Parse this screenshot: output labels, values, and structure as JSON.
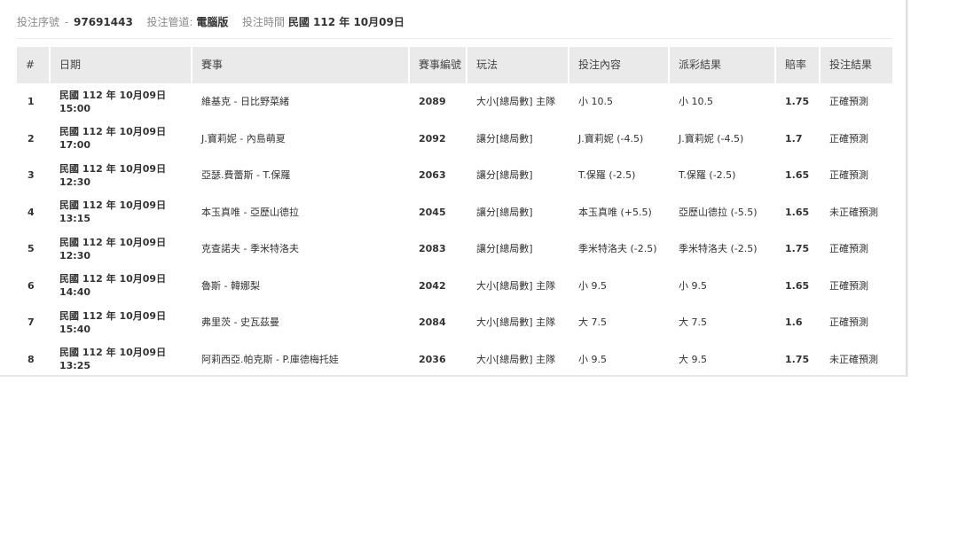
{
  "header": {
    "serial_label": "投注序號",
    "serial_sep": "-",
    "serial_value": "97691443",
    "channel_label": "投注管道:",
    "channel_value": "電腦版",
    "time_label": "投注時間",
    "time_value": "民國 112 年 10月09日"
  },
  "table": {
    "columns": [
      "#",
      "日期",
      "賽事",
      "賽事編號",
      "玩法",
      "投注內容",
      "派彩結果",
      "賠率",
      "投注結果"
    ],
    "rows": [
      {
        "idx": "1",
        "date": "民國 112 年 10月09日",
        "time": "15:00",
        "match": "維基克 - 日比野菜緒",
        "match_no": "2089",
        "play": "大小[總局數] 主隊",
        "bet": "小 10.5",
        "payout": "小 10.5",
        "odds": "1.75",
        "result": "正確預測"
      },
      {
        "idx": "2",
        "date": "民國 112 年 10月09日",
        "time": "17:00",
        "match": "J.寶莉妮 - 內島萌夏",
        "match_no": "2092",
        "play": "讓分[總局數]",
        "bet": "J.寶莉妮 (-4.5)",
        "payout": "J.寶莉妮 (-4.5)",
        "odds": "1.7",
        "result": "正確預測"
      },
      {
        "idx": "3",
        "date": "民國 112 年 10月09日",
        "time": "12:30",
        "match": "亞瑟.費蕾斯 - T.保羅",
        "match_no": "2063",
        "play": "讓分[總局數]",
        "bet": "T.保羅 (-2.5)",
        "payout": "T.保羅 (-2.5)",
        "odds": "1.65",
        "result": "正確預測"
      },
      {
        "idx": "4",
        "date": "民國 112 年 10月09日",
        "time": "13:15",
        "match": "本玉真唯 - 亞歷山德拉",
        "match_no": "2045",
        "play": "讓分[總局數]",
        "bet": "本玉真唯 (+5.5)",
        "payout": "亞歷山德拉 (-5.5)",
        "odds": "1.65",
        "result": "未正確預測"
      },
      {
        "idx": "5",
        "date": "民國 112 年 10月09日",
        "time": "12:30",
        "match": "克查諾夫 - 季米特洛夫",
        "match_no": "2083",
        "play": "讓分[總局數]",
        "bet": "季米特洛夫 (-2.5)",
        "payout": "季米特洛夫 (-2.5)",
        "odds": "1.75",
        "result": "正確預測"
      },
      {
        "idx": "6",
        "date": "民國 112 年 10月09日",
        "time": "14:40",
        "match": "魯斯 - 韓娜梨",
        "match_no": "2042",
        "play": "大小[總局數] 主隊",
        "bet": "小 9.5",
        "payout": "小 9.5",
        "odds": "1.65",
        "result": "正確預測"
      },
      {
        "idx": "7",
        "date": "民國 112 年 10月09日",
        "time": "15:40",
        "match": "弗里茨 - 史瓦茲曼",
        "match_no": "2084",
        "play": "大小[總局數] 主隊",
        "bet": "大 7.5",
        "payout": "大 7.5",
        "odds": "1.6",
        "result": "正確預測"
      },
      {
        "idx": "8",
        "date": "民國 112 年 10月09日",
        "time": "13:25",
        "match": "阿莉西亞.帕克斯 - P.庫德梅托娃",
        "match_no": "2036",
        "play": "大小[總局數] 主隊",
        "bet": "小 9.5",
        "payout": "大 9.5",
        "odds": "1.75",
        "result": "未正確預測"
      }
    ]
  }
}
